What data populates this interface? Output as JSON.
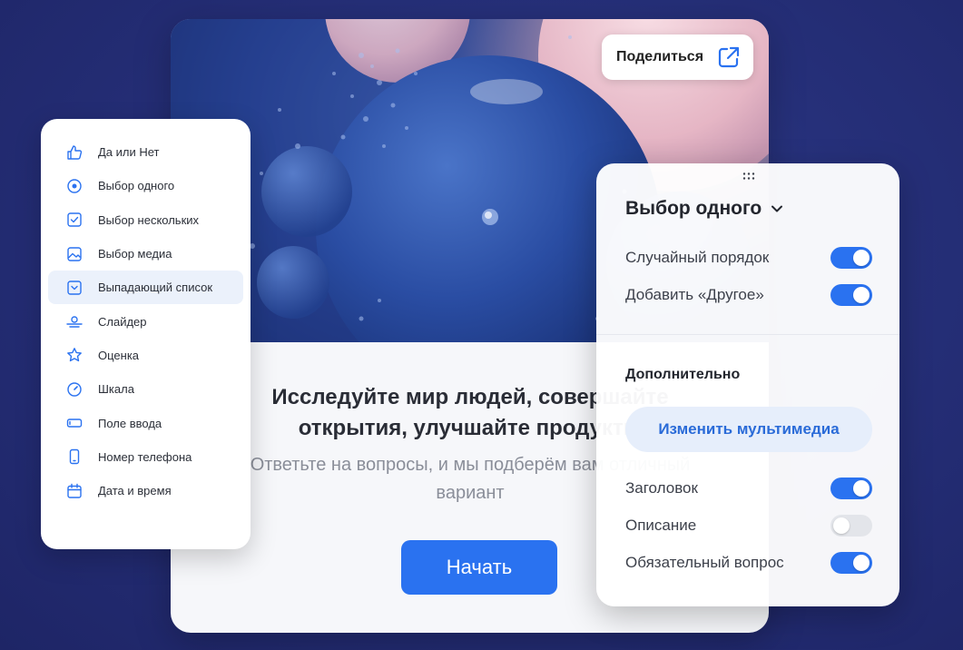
{
  "share": {
    "label": "Поделиться",
    "icon": "external-link-icon"
  },
  "hero": {
    "headline": "Исследуйте мир людей, совершайте открытия, улучшайте продукты",
    "subline": "Ответьте на вопросы, и мы подберём вам отличный вариант",
    "start_label": "Начать"
  },
  "question_types": [
    {
      "label": "Да или Нет",
      "icon": "thumbs-up-icon"
    },
    {
      "label": "Выбор одного",
      "icon": "radio-icon"
    },
    {
      "label": "Выбор нескольких",
      "icon": "checkbox-icon"
    },
    {
      "label": "Выбор медиа",
      "icon": "image-icon"
    },
    {
      "label": "Выпадающий список",
      "icon": "dropdown-icon",
      "active": true
    },
    {
      "label": "Слайдер",
      "icon": "slider-icon"
    },
    {
      "label": "Оценка",
      "icon": "star-icon"
    },
    {
      "label": "Шкала",
      "icon": "gauge-icon"
    },
    {
      "label": "Поле ввода",
      "icon": "input-field-icon"
    },
    {
      "label": "Номер телефона",
      "icon": "phone-icon"
    },
    {
      "label": "Дата и время",
      "icon": "calendar-icon"
    }
  ],
  "settings": {
    "title": "Выбор одного",
    "random_order": {
      "label": "Случайный порядок",
      "on": true
    },
    "add_other": {
      "label": "Добавить «Другое»",
      "on": true
    },
    "section_title": "Дополнительно",
    "media_button": "Изменить мультимедиа",
    "heading": {
      "label": "Заголовок",
      "on": true
    },
    "description": {
      "label": "Описание",
      "on": false
    },
    "required": {
      "label": "Обязательный вопрос",
      "on": true
    }
  },
  "colors": {
    "accent": "#2a72f0",
    "background": "#26307a",
    "card": "#f6f7fa"
  }
}
